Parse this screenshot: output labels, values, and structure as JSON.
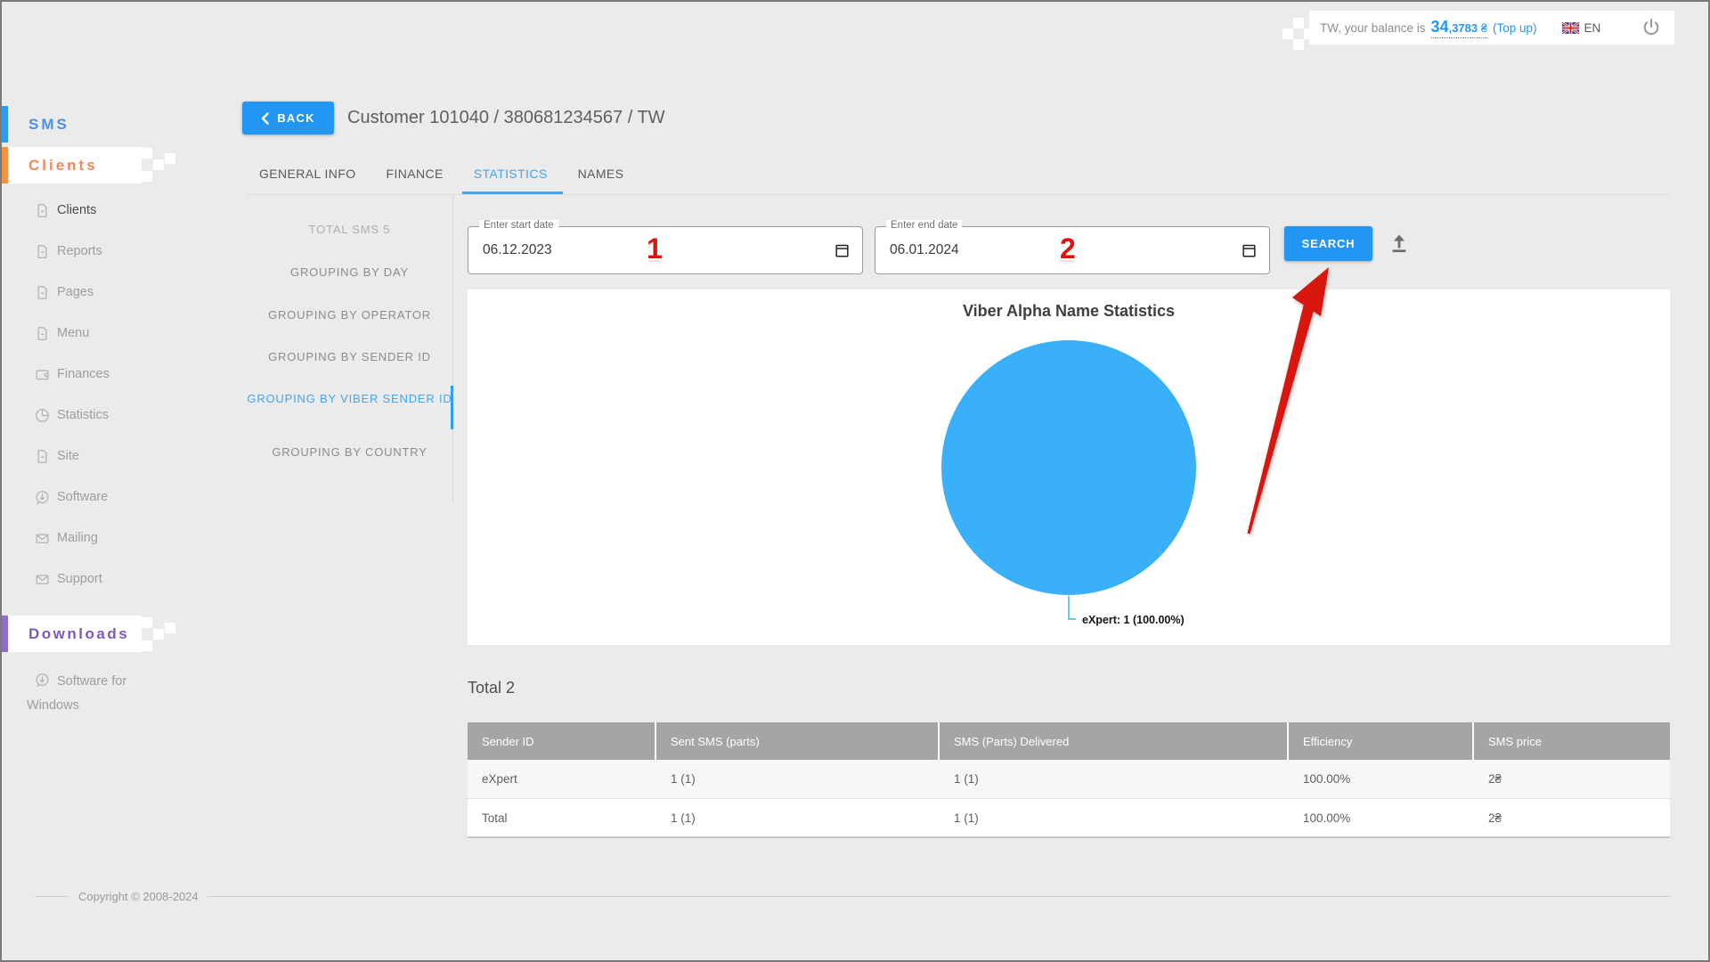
{
  "colors": {
    "accent": "#2196f3",
    "pie_blue": "#3ab0f8",
    "annotation_red": "#d8160d",
    "sms_blue": "#4a90e8",
    "clients_orange": "#f4865a",
    "downloads_purple": "#7e57c2",
    "table_header_bg": "#a5a5a5"
  },
  "top_bar": {
    "balance_prefix": "TW, your balance is",
    "balance_int": "34",
    "balance_frac": ",3783",
    "currency": "₴",
    "top_up": "(Top up)",
    "language": "EN",
    "flag_icon": "uk-flag-icon",
    "power_icon": "power-icon"
  },
  "sidebar": {
    "sms_header": "SMS",
    "clients_header": "Clients",
    "downloads_header": "Downloads",
    "items": [
      {
        "label": "Clients",
        "icon": "document-icon",
        "active": true
      },
      {
        "label": "Reports",
        "icon": "document-icon"
      },
      {
        "label": "Pages",
        "icon": "document-icon"
      },
      {
        "label": "Menu",
        "icon": "document-icon"
      },
      {
        "label": "Finances",
        "icon": "wallet-icon"
      },
      {
        "label": "Statistics",
        "icon": "pie-chart-icon"
      },
      {
        "label": "Site",
        "icon": "document-icon"
      },
      {
        "label": "Software",
        "icon": "download-bubble-icon"
      },
      {
        "label": "Mailing",
        "icon": "envelope-icon"
      },
      {
        "label": "Support",
        "icon": "envelope-icon"
      }
    ],
    "downloads_items": [
      {
        "label": "Software for Windows",
        "icon": "download-bubble-icon"
      }
    ]
  },
  "header": {
    "back_label": "BACK",
    "title": "Customer 101040 / 380681234567 / TW",
    "tabs": [
      {
        "label": "GENERAL INFO",
        "active": false
      },
      {
        "label": "FINANCE",
        "active": false
      },
      {
        "label": "STATISTICS",
        "active": true
      },
      {
        "label": "NAMES",
        "active": false
      }
    ]
  },
  "subnav": {
    "items": [
      {
        "label": "TOTAL SMS 5",
        "active": false
      },
      {
        "label": "GROUPING BY DAY",
        "active": false
      },
      {
        "label": "GROUPING BY OPERATOR",
        "active": false
      },
      {
        "label": "GROUPING BY SENDER ID",
        "active": false
      },
      {
        "label": "GROUPING BY VIBER SENDER ID",
        "active": true
      },
      {
        "label": "GROUPING BY COUNTRY",
        "active": false
      }
    ]
  },
  "filters": {
    "start": {
      "label": "Enter start date",
      "value": "06.12.2023",
      "annotation": "1"
    },
    "end": {
      "label": "Enter end date",
      "value": "06.01.2024",
      "annotation": "2"
    },
    "search_label": "SEARCH"
  },
  "chart_data": {
    "type": "pie",
    "title": "Viber Alpha Name Statistics",
    "slices": [
      {
        "label": "eXpert",
        "value": 1,
        "percent": 100.0,
        "color": "#3ab0f8"
      }
    ],
    "point_label": "eXpert: 1 (100.00%)",
    "legend_position": "none",
    "background": "#ffffff"
  },
  "table": {
    "total_label": "Total 2",
    "columns": [
      "Sender ID",
      "Sent SMS (parts)",
      "SMS (Parts) Delivered",
      "Efficiency",
      "SMS price"
    ],
    "rows": [
      [
        "eXpert",
        "1 (1)",
        "1 (1)",
        "100.00%",
        "2₴"
      ],
      [
        "Total",
        "1 (1)",
        "1 (1)",
        "100.00%",
        "2₴"
      ]
    ]
  },
  "footer": {
    "copyright": "Copyright © 2008-2024"
  }
}
